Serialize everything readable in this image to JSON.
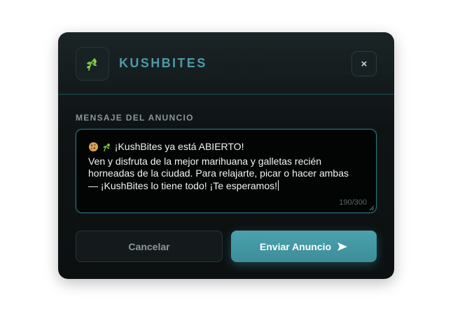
{
  "modal": {
    "brand": "KUSHBITES",
    "close_label": "×",
    "field_label": "MENSAJE DEL ANUNCIO",
    "message_line1": "¡KushBites ya está ABIERTO!",
    "message_body": "Ven y disfruta de la mejor marihuana y galletas recién\nhorneadas de la ciudad. Para relajarte, picar o hacer ambas\n— ¡KushBites lo tiene todo! ¡Te esperamos!",
    "char_counter": "190/300",
    "cancel_label": "Cancelar",
    "send_label": "Enviar Anuncio"
  },
  "icons": {
    "logo": "leaf-icon",
    "close": "close-icon",
    "cookie": "cookie-icon",
    "herb": "leaf-icon",
    "send": "send-icon"
  },
  "colors": {
    "accent": "#4e9aa6",
    "leaf": "#7cc242",
    "button": "#44999f"
  }
}
